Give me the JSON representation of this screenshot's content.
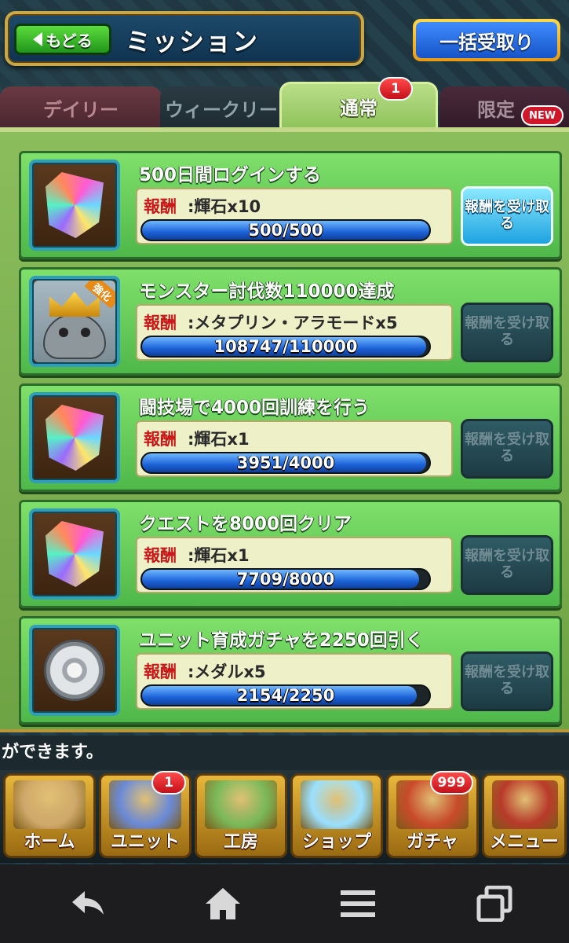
{
  "header": {
    "back_label": "もどる",
    "title": "ミッション",
    "bulk_claim_label": "一括受取り"
  },
  "tabs": [
    {
      "label": "デイリー",
      "selected": false
    },
    {
      "label": "ウィークリー",
      "selected": false
    },
    {
      "label": "通常",
      "selected": true,
      "badge": "1"
    },
    {
      "label": "限定",
      "selected": false,
      "badge": "NEW"
    }
  ],
  "missions": [
    {
      "name": "500日間ログインする",
      "reward_label": "報酬",
      "reward": ":輝石x10",
      "progress_text": "500/500",
      "progress": 1.0,
      "icon": "gem-icon",
      "claim_label": "報酬を受け取る",
      "claimable": true
    },
    {
      "name": "モンスター討伐数110000達成",
      "reward_label": "報酬",
      "reward": ":メタプリン・アラモードx5",
      "progress_text": "108747/110000",
      "progress": 0.9886,
      "icon": "monster-icon",
      "icon_tag": "強化",
      "claim_label": "報酬を受け取る",
      "claimable": false
    },
    {
      "name": "闘技場で4000回訓練を行う",
      "reward_label": "報酬",
      "reward": ":輝石x1",
      "progress_text": "3951/4000",
      "progress": 0.9878,
      "icon": "gem-icon",
      "claim_label": "報酬を受け取る",
      "claimable": false
    },
    {
      "name": "クエストを8000回クリア",
      "reward_label": "報酬",
      "reward": ":輝石x1",
      "progress_text": "7709/8000",
      "progress": 0.9636,
      "icon": "gem-icon",
      "claim_label": "報酬を受け取る",
      "claimable": false
    },
    {
      "name": "ユニット育成ガチャを2250回引く",
      "reward_label": "報酬",
      "reward": ":メダルx5",
      "progress_text": "2154/2250",
      "progress": 0.9573,
      "icon": "medal-icon",
      "claim_label": "報酬を受け取る",
      "claimable": false
    }
  ],
  "message": "ができます。",
  "bottom_nav": [
    {
      "label": "ホーム",
      "icon": "map-icon",
      "color": "#cfa96a"
    },
    {
      "label": "ユニット",
      "icon": "knight-icon",
      "color": "#6a8ad8",
      "badge": "1"
    },
    {
      "label": "工房",
      "icon": "windmill-icon",
      "color": "#7ab85a"
    },
    {
      "label": "ショップ",
      "icon": "gem-icon",
      "color": "#9ae0ff"
    },
    {
      "label": "ガチャ",
      "icon": "shield-door-icon",
      "color": "#c84a2a",
      "badge": "999"
    },
    {
      "label": "メニュー",
      "icon": "book-icon",
      "color": "#b83a2a"
    }
  ],
  "system_bar": {
    "buttons": [
      "back-icon",
      "home-icon",
      "menu-icon",
      "recent-apps-icon"
    ]
  }
}
